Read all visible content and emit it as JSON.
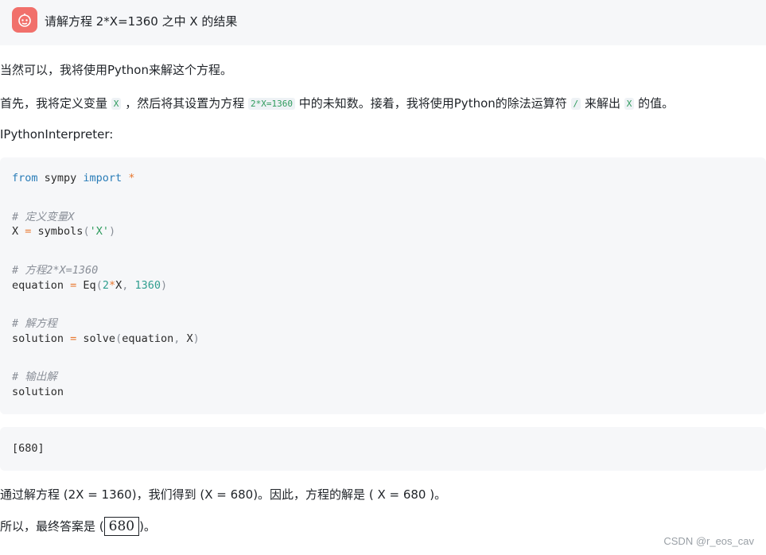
{
  "user_message": "请解方程 2*X=1360 之中 X 的结果",
  "avatar_icon": "robot-face-icon",
  "response": {
    "intro": "当然可以，我将使用Python来解这个方程。",
    "p2_a": "首先，我将定义变量",
    "p2_code1": "X",
    "p2_b": "，然后将其设置为方程",
    "p2_code2": "2*X=1360",
    "p2_c": "中的未知数。接着，我将使用Python的除法运算符",
    "p2_code3": "/",
    "p2_d": "来解出",
    "p2_code4": "X",
    "p2_e": "的值。",
    "tool_label": "IPythonInterpreter:"
  },
  "code": {
    "l1_from": "from",
    "l1_mod": " sympy ",
    "l1_import": "import",
    "l1_star": " *",
    "c1": "# 定义变量X",
    "l2_var": "X ",
    "l2_eq": "=",
    "l2_fn": " symbols",
    "l2_p1": "(",
    "l2_str": "'X'",
    "l2_p2": ")",
    "c2": "# 方程2*X=1360",
    "l3_var": "equation ",
    "l3_eq": "=",
    "l3_fn": " Eq",
    "l3_p1": "(",
    "l3_n1": "2",
    "l3_op": "*",
    "l3_x": "X",
    "l3_comma": ", ",
    "l3_n2": "1360",
    "l3_p2": ")",
    "c3": "# 解方程",
    "l4_var": "solution ",
    "l4_eq": "=",
    "l4_fn": " solve",
    "l4_p1": "(",
    "l4_args": "equation",
    "l4_comma": ", ",
    "l4_x": "X",
    "l4_p2": ")",
    "c4": "# 输出解",
    "l5": "solution"
  },
  "output": "[680]",
  "conclusion": "通过解方程 (2X = 1360)，我们得到 (X = 680)。因此，方程的解是 ( X = 680 )。",
  "final_a": "所以，最终答案是 (",
  "final_boxed": "680",
  "final_b": ")。",
  "watermark": "CSDN @r_eos_cav"
}
